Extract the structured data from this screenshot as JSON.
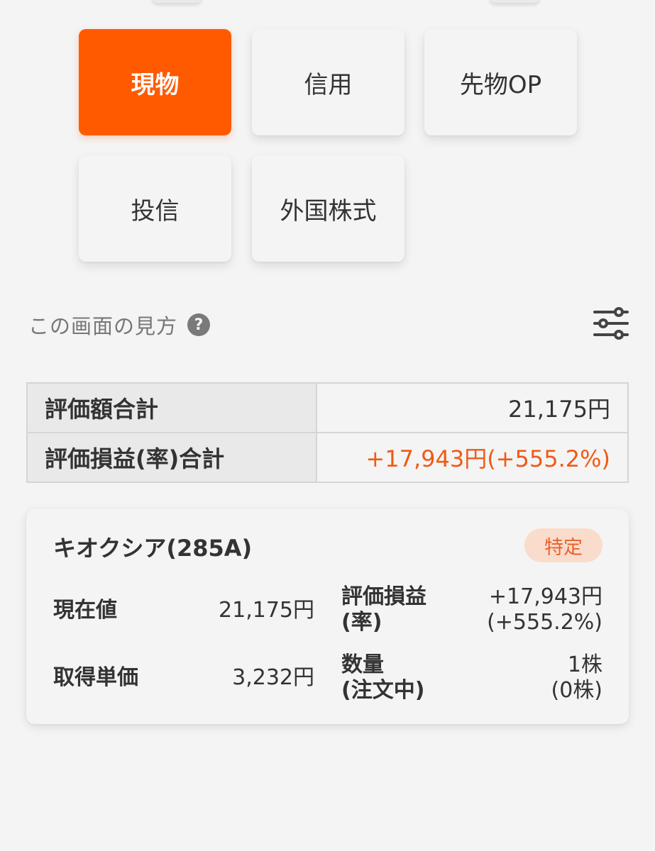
{
  "tabs": [
    {
      "label": "現物",
      "active": true
    },
    {
      "label": "信用",
      "active": false
    },
    {
      "label": "先物OP",
      "active": false
    },
    {
      "label": "投信",
      "active": false
    },
    {
      "label": "外国株式",
      "active": false
    }
  ],
  "help": {
    "text": "この画面の見方",
    "icon": "question-circle-icon",
    "question_mark": "?"
  },
  "filter_icon": "sliders-icon",
  "summary": {
    "valuation_total_label": "評価額合計",
    "valuation_total_value": "21,175円",
    "pl_total_label": "評価損益(率)合計",
    "pl_total_value": "+17,943円(+555.2%)"
  },
  "holding": {
    "name": "キオクシア(285A)",
    "badge": "特定",
    "current_price_label": "現在値",
    "current_price_value": "21,175円",
    "pl_label_line1": "評価損益",
    "pl_label_line2": "(率)",
    "pl_value_line1": "+17,943円",
    "pl_value_line2": "(+555.2%)",
    "cost_label": "取得単価",
    "cost_value": "3,232円",
    "qty_label_line1": "数量",
    "qty_label_line2": "(注文中)",
    "qty_value_line1": "1株",
    "qty_value_line2": "(0株)"
  },
  "colors": {
    "accent": "#ff5a00",
    "gain": "#f05a14",
    "badge_bg": "#fadccd"
  }
}
